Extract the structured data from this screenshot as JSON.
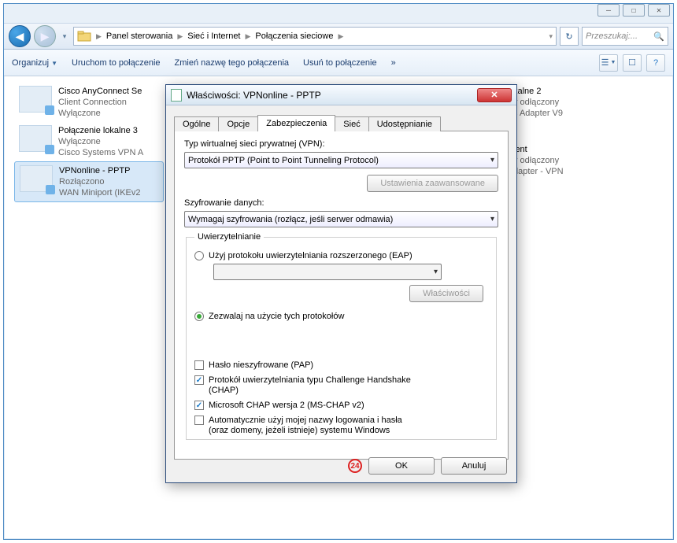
{
  "breadcrumb": [
    "Panel sterowania",
    "Sieć i Internet",
    "Połączenia sieciowe"
  ],
  "search_placeholder": "Przeszukaj:...",
  "toolbar": {
    "organize": "Organizuj",
    "start": "Uruchom to połączenie",
    "rename": "Zmień nazwę tego połączenia",
    "delete": "Usuń to połączenie"
  },
  "connections_left": [
    {
      "name": "Cisco AnyConnect Se",
      "line2": "Client Connection",
      "status": "Wyłączone",
      "sub": ""
    },
    {
      "name": "Połączenie lokalne 3",
      "line2": "Wyłączone",
      "status": "Cisco Systems VPN A",
      "sub": ""
    },
    {
      "name": "VPNonline - PPTP",
      "line2": "Rozłączono",
      "status": "WAN Miniport (IKEv2",
      "sub": "",
      "selected": true
    }
  ],
  "connections_right": [
    {
      "name": "kalne 2",
      "line2": "y odłączony",
      "status": "s Adapter V9"
    },
    {
      "name": "ient",
      "line2": "y odłączony",
      "status": "dapter - VPN"
    }
  ],
  "dialog": {
    "title": "Właściwości: VPNonline - PPTP",
    "tabs": [
      "Ogólne",
      "Opcje",
      "Zabezpieczenia",
      "Sieć",
      "Udostępnianie"
    ],
    "active_tab": 2,
    "vpn_type_label": "Typ wirtualnej sieci prywatnej (VPN):",
    "vpn_type_value": "Protokół PPTP (Point to Point Tunneling Protocol)",
    "advanced_btn": "Ustawienia zaawansowane",
    "encrypt_label": "Szyfrowanie danych:",
    "encrypt_value": "Wymagaj szyfrowania (rozłącz, jeśli serwer odmawia)",
    "auth_legend": "Uwierzytelnianie",
    "eap_radio": "Użyj protokołu uwierzytelniania rozszerzonego (EAP)",
    "properties_btn": "Właściwości",
    "allow_radio": "Zezwalaj na użycie tych protokołów",
    "pap_label": "Hasło nieszyfrowane (PAP)",
    "chap_label": "Protokół uwierzytelniania typu Challenge Handshake (CHAP)",
    "mschap_label": "Microsoft CHAP wersja 2 (MS-CHAP v2)",
    "auto_label": "Automatycznie użyj mojej nazwy logowania i hasła (oraz domeny, jeżeli istnieje) systemu Windows",
    "ok": "OK",
    "cancel": "Anuluj",
    "annotation": "24"
  }
}
